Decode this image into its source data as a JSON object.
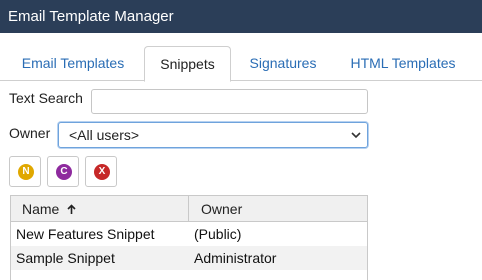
{
  "window": {
    "title": "Email Template Manager"
  },
  "tabs": [
    {
      "label": "Email Templates",
      "active": false
    },
    {
      "label": "Snippets",
      "active": true
    },
    {
      "label": "Signatures",
      "active": false
    },
    {
      "label": "HTML Templates",
      "active": false
    }
  ],
  "filters": {
    "text_search_label": "Text Search",
    "text_search_value": "",
    "owner_label": "Owner",
    "owner_selected": "<All users>"
  },
  "toolbar": {
    "buttons": [
      {
        "name": "new",
        "glyph": "N",
        "color": "#e0a800",
        "icon": "new-icon"
      },
      {
        "name": "copy",
        "glyph": "C",
        "color": "#8e2a9e",
        "icon": "copy-icon"
      },
      {
        "name": "delete",
        "glyph": "X",
        "color": "#c62828",
        "icon": "delete-icon"
      }
    ]
  },
  "table": {
    "columns": [
      {
        "label": "Name",
        "sort": "ascending"
      },
      {
        "label": "Owner"
      }
    ],
    "rows": [
      {
        "name": "New Features Snippet",
        "owner": "(Public)"
      },
      {
        "name": "Sample Snippet",
        "owner": "Administrator"
      }
    ]
  },
  "colors": {
    "titlebar": "#2b3e58",
    "tab_link": "#2a6db5",
    "select_focus": "#6fa3dc"
  }
}
